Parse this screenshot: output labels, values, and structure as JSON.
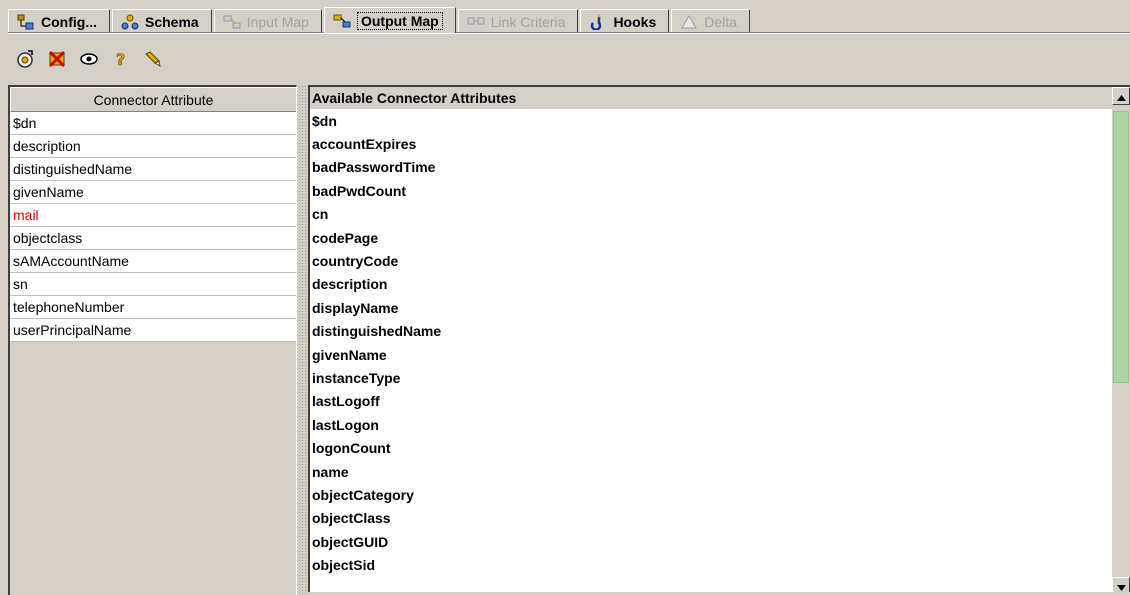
{
  "tabs": [
    {
      "label": "Config...",
      "icon": "config-icon",
      "state": "normal"
    },
    {
      "label": "Schema",
      "icon": "schema-icon",
      "state": "normal"
    },
    {
      "label": "Input Map",
      "icon": "input-map-icon",
      "state": "disabled"
    },
    {
      "label": "Output Map",
      "icon": "output-map-icon",
      "state": "active"
    },
    {
      "label": "Link Criteria",
      "icon": "link-criteria-icon",
      "state": "disabled"
    },
    {
      "label": "Hooks",
      "icon": "hooks-icon",
      "state": "normal"
    },
    {
      "label": "Delta",
      "icon": "delta-icon",
      "state": "disabled"
    }
  ],
  "toolbar": {
    "buttons": [
      "add-icon",
      "delete-icon",
      "view-icon",
      "help-icon",
      "pen-icon"
    ]
  },
  "left_table": {
    "header": "Connector Attribute",
    "rows": [
      "$dn",
      "description",
      "distinguishedName",
      "givenName",
      "mail",
      "objectclass",
      "sAMAccountName",
      "sn",
      "telephoneNumber",
      "userPrincipalName"
    ],
    "highlight_color": "#e00000"
  },
  "right_table": {
    "header": "Available Connector Attributes",
    "rows": [
      "$dn",
      "accountExpires",
      "badPasswordTime",
      "badPwdCount",
      "cn",
      "codePage",
      "countryCode",
      "description",
      "displayName",
      "distinguishedName",
      "givenName",
      "instanceType",
      "lastLogoff",
      "lastLogon",
      "logonCount",
      "name",
      "objectCategory",
      "objectClass",
      "objectGUID",
      "objectSid"
    ]
  },
  "colors": {
    "window_bg": "#d4d0c8",
    "scroll_thumb": "#b8dcb0"
  }
}
